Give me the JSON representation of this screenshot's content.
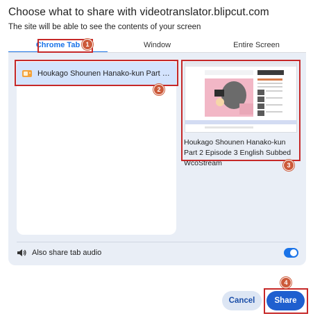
{
  "dialog": {
    "title": "Choose what to share with videotranslator.blipcut.com",
    "subtitle": "The site will be able to see the contents of your screen"
  },
  "tabs": [
    {
      "label": "Chrome Tab",
      "active": true
    },
    {
      "label": "Window",
      "active": false
    },
    {
      "label": "Entire Screen",
      "active": false
    }
  ],
  "source_list": {
    "items": [
      {
        "title": "Houkago Shounen Hanako-kun Part 2 Episode 3 English Subbed WcoStream",
        "icon": "tv-favicon-icon",
        "selected": true
      }
    ]
  },
  "preview": {
    "caption": "Houkago Shounen Hanako-kun Part 2 Episode 3 English Subbed WcoStream"
  },
  "audio": {
    "label": "Also share tab audio",
    "enabled": true
  },
  "buttons": {
    "cancel": "Cancel",
    "share": "Share"
  },
  "annotations": {
    "markers": [
      "1",
      "2",
      "3",
      "4"
    ]
  },
  "colors": {
    "accent": "#1a73e8",
    "panel": "#e9eef6",
    "selected_item": "#d3e3fd",
    "highlight": "#c62828",
    "marker": "#cc5a3a"
  }
}
